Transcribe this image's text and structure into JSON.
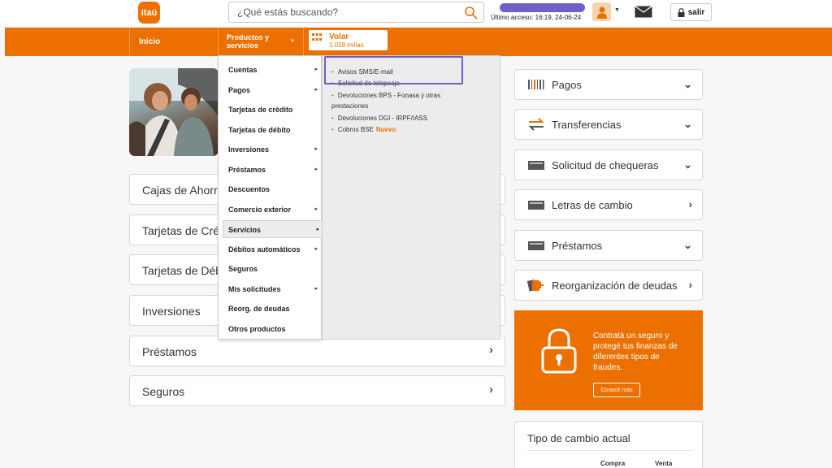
{
  "header": {
    "logo_text": "itaú",
    "search_placeholder": "¿Qué estás buscando?",
    "last_access": "Último acceso: 16:19, 24-06-24",
    "logout_label": "salir"
  },
  "nav": {
    "home": "Inicio",
    "products": "Productos y servicios",
    "volar_title": "Volar",
    "volar_miles": "1.018 millas"
  },
  "accordion": [
    {
      "label": "Cajas de Ahorro"
    },
    {
      "label": "Tarjetas de Crédito"
    },
    {
      "label": "Tarjetas de Débito"
    },
    {
      "label": "Inversiones"
    },
    {
      "label": "Préstamos",
      "arrow": "›"
    },
    {
      "label": "Seguros",
      "arrow": "›"
    }
  ],
  "menu": [
    {
      "label": "Cuentas",
      "arrow": "▸"
    },
    {
      "label": "Pagos",
      "arrow": "▸"
    },
    {
      "label": "Tarjetas de crédito"
    },
    {
      "label": "Tarjetas de débito"
    },
    {
      "label": "Inversiones",
      "arrow": "▸"
    },
    {
      "label": "Préstamos",
      "arrow": "▸"
    },
    {
      "label": "Descuentos"
    },
    {
      "label": "Comercio exterior",
      "arrow": "▸"
    },
    {
      "label": "Servicios",
      "arrow": "▸"
    },
    {
      "label": "Débitos automáticos",
      "arrow": "▸"
    },
    {
      "label": "Seguros"
    },
    {
      "label": "Mis solicitudes",
      "arrow": "▸"
    },
    {
      "label": "Reorg. de deudas"
    },
    {
      "label": "Otros productos"
    }
  ],
  "submenu": [
    {
      "label": "Avisos SMS/E-mail"
    },
    {
      "label": "Solicitud de telepeaje"
    },
    {
      "label": "Devoluciones BPS - Fonasa y otras prestaciones"
    },
    {
      "label": "Devoluciones DGI - IRPF/IASS"
    },
    {
      "label": "Cobros BSE",
      "badge": "Nuevo"
    }
  ],
  "quick": [
    {
      "label": "Pagos",
      "arrow": "⌄",
      "icon": "barcode-icon"
    },
    {
      "label": "Transferencias",
      "arrow": "⌄",
      "icon": "transfer-icon"
    },
    {
      "label": "Solicitud de chequeras",
      "arrow": "⌄",
      "icon": "checkbook-icon"
    },
    {
      "label": "Letras de cambio",
      "arrow": "›",
      "icon": "bill-icon"
    },
    {
      "label": "Préstamos",
      "arrow": "⌄",
      "icon": "loan-icon"
    },
    {
      "label": "Reorganización de deudas",
      "arrow": "›",
      "icon": "debt-icon"
    }
  ],
  "promo": {
    "text": "Contratá un seguro y protegé tus finanzas de diferentes tipos de fraudes.",
    "button": "Conocé más"
  },
  "rates": {
    "title": "Tipo de cambio actual",
    "buy": "Compra",
    "sell": "Venta"
  },
  "colors": {
    "brand": "#ec7000",
    "highlight": "#6f5fc7"
  }
}
